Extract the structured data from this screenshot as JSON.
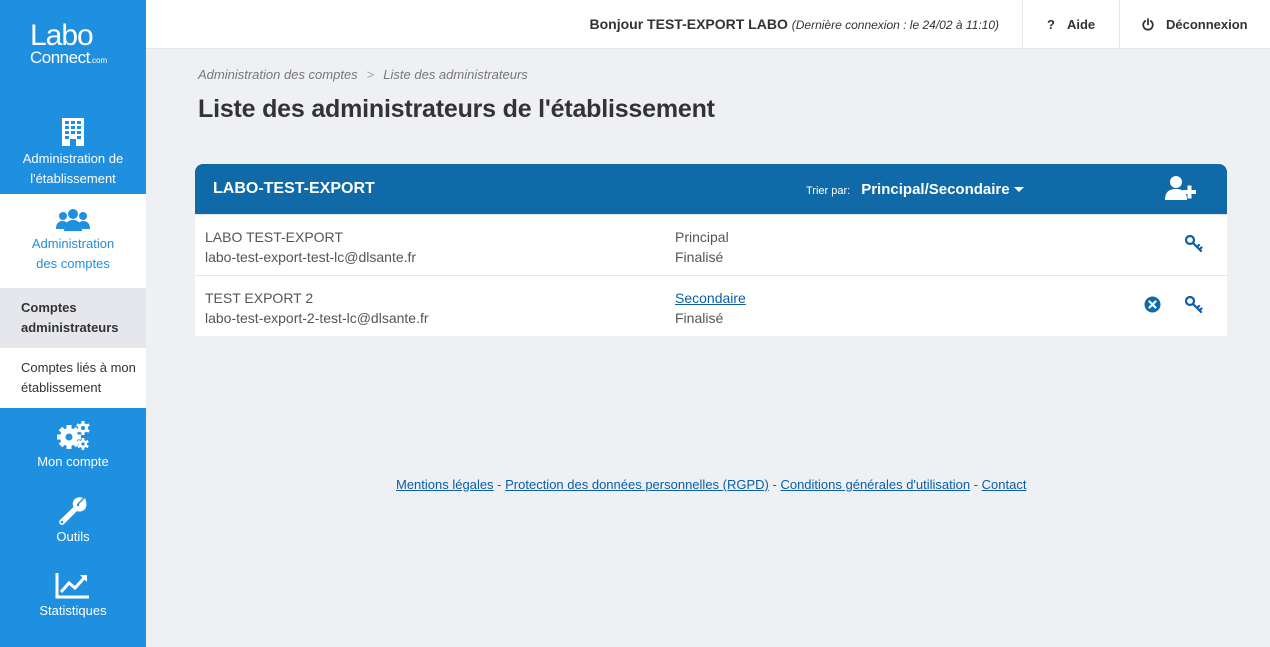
{
  "sidebar": {
    "logo_line1": "Labo",
    "logo_line2": "Connect",
    "logo_suffix": ".com",
    "nav": {
      "etablissement": "Administration de l'établissement",
      "comptes": "Administration des comptes",
      "sub_admins": "Comptes administrateurs",
      "sub_lies": "Comptes liés à mon établissement",
      "mon_compte": "Mon compte",
      "outils": "Outils",
      "statistiques": "Statistiques"
    }
  },
  "topbar": {
    "greeting": "Bonjour TEST-EXPORT LABO",
    "last_login": "(Dernière connexion : le 24/02 à 11:10)",
    "help_icon": "?",
    "help": "Aide",
    "logout": "Déconnexion"
  },
  "breadcrumb": {
    "items": [
      "Administration des comptes",
      "Liste des administrateurs"
    ],
    "separator": ">"
  },
  "page_title": "Liste des administrateurs de l'établissement",
  "panel": {
    "name": "LABO-TEST-EXPORT",
    "sort_label": "Trier par:",
    "sort_value": "Principal/Secondaire",
    "rows": [
      {
        "name": "LABO TEST-EXPORT",
        "email": "labo-test-export-test-lc@dlsante.fr",
        "role": "Principal",
        "status": "Finalisé"
      },
      {
        "name": "TEST EXPORT 2",
        "email": "labo-test-export-2-test-lc@dlsante.fr",
        "role": "Secondaire",
        "status": "Finalisé"
      }
    ]
  },
  "footer": {
    "links": [
      "Mentions légales",
      "Protection des données personnelles (RGPD)",
      "Conditions générales d'utilisation",
      "Contact"
    ],
    "separator": " - "
  },
  "colors": {
    "sidebar": "#1f8fe0",
    "panel_header": "#116aa8",
    "link": "#0b5ea8",
    "background": "#eef0f4"
  },
  "icons": {
    "etablissement": "building-icon",
    "comptes": "users-icon",
    "mon_compte": "gears-icon",
    "outils": "wrench-icon",
    "statistiques": "chart-line-icon",
    "add": "add-user-icon",
    "key": "key-icon",
    "delete": "close-circle-icon",
    "logout": "power-icon"
  }
}
